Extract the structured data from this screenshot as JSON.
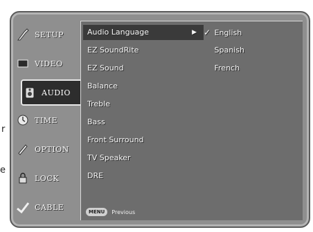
{
  "left_marks": [
    {
      "text": "r"
    },
    {
      "text": "e"
    }
  ],
  "sidebar": {
    "items": [
      {
        "label": "SETUP",
        "icon": "setup-icon",
        "active": false
      },
      {
        "label": "VIDEO",
        "icon": "video-icon",
        "active": false
      },
      {
        "label": "AUDIO",
        "icon": "audio-icon",
        "active": true
      },
      {
        "label": "TIME",
        "icon": "time-icon",
        "active": false
      },
      {
        "label": "OPTION",
        "icon": "option-icon",
        "active": false
      },
      {
        "label": "LOCK",
        "icon": "lock-icon",
        "active": false
      },
      {
        "label": "CABLE",
        "icon": "cable-icon",
        "active": false
      }
    ]
  },
  "menu": {
    "items": [
      {
        "label": "Audio Language",
        "has_submenu": true
      },
      {
        "label": "EZ SoundRite"
      },
      {
        "label": "EZ Sound"
      },
      {
        "label": "Balance"
      },
      {
        "label": "Treble"
      },
      {
        "label": "Bass"
      },
      {
        "label": "Front Surround"
      },
      {
        "label": "TV Speaker"
      },
      {
        "label": "DRE"
      }
    ],
    "arrow": "▶"
  },
  "options": {
    "items": [
      {
        "label": "English",
        "checked": true
      },
      {
        "label": "Spanish",
        "checked": false
      },
      {
        "label": "French",
        "checked": false
      }
    ],
    "checkmark": "✓"
  },
  "footer": {
    "key_label": "MENU",
    "text": "Previous"
  }
}
